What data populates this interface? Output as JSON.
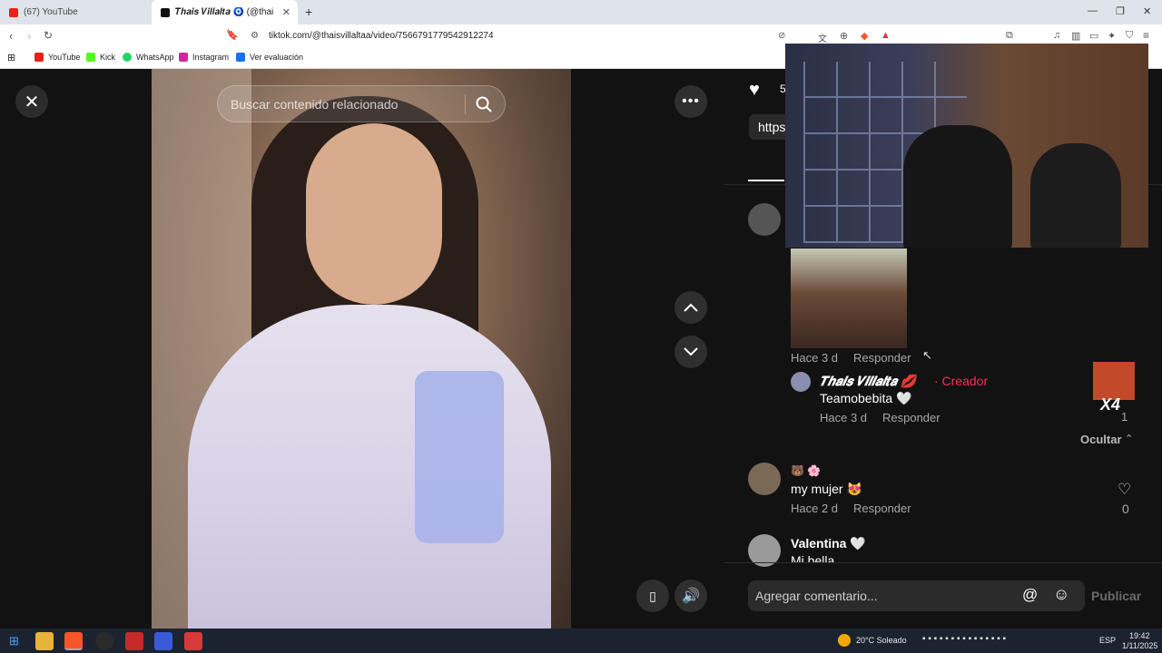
{
  "browser": {
    "tabs": [
      {
        "label": "(67) YouTube"
      },
      {
        "label": "𝑻𝒉𝒂𝒊𝒔 𝑽𝒊𝒍𝒍𝒂𝒍𝒕𝒂 🧿 (@thai"
      }
    ],
    "new_tab": "+",
    "url": "tiktok.com/@thaisvillaltaa/video/7566791779542912274",
    "bookmarks": [
      {
        "label": "YouTube",
        "color": "#e62117"
      },
      {
        "label": "Kick",
        "color": "#111111"
      },
      {
        "label": "WhatsApp",
        "color": "#25d366"
      },
      {
        "label": "Instagram",
        "color": "#d6249f"
      },
      {
        "label": "Ver evaluación",
        "color": "#1a73e8"
      }
    ]
  },
  "player": {
    "search_placeholder": "Buscar contenido relacionado"
  },
  "panel": {
    "like_count": "5",
    "link_preview": "https",
    "comments": [
      {
        "time": "Hace 3 d",
        "reply": "Responder"
      },
      {
        "author": "𝑻𝒉𝒂𝒊𝒔 𝑽𝒊𝒍𝒍𝒂𝒍𝒕𝒂 💋",
        "role": "· Creador",
        "text": "Teamobebita 🤍",
        "time": "Hace 3 d",
        "reply": "Responder",
        "likes": "1"
      },
      {
        "author": "🐻 🌸",
        "text": "my mujer 😻",
        "time": "Hace 2 d",
        "reply": "Responder",
        "likes": "0"
      },
      {
        "author": "Valentina 🤍",
        "text": "Mi bella"
      }
    ],
    "hide_label": "Ocultar",
    "sticker_text": "X4",
    "composer_placeholder": "Agregar comentario...",
    "publish": "Publicar"
  },
  "taskbar": {
    "weather": "20°C  Soleado",
    "lang": "ESP",
    "time": "19:42",
    "date": "1/11/2025"
  },
  "colors": {
    "creator_red": "#fe2c55",
    "page_bg": "#121212"
  }
}
